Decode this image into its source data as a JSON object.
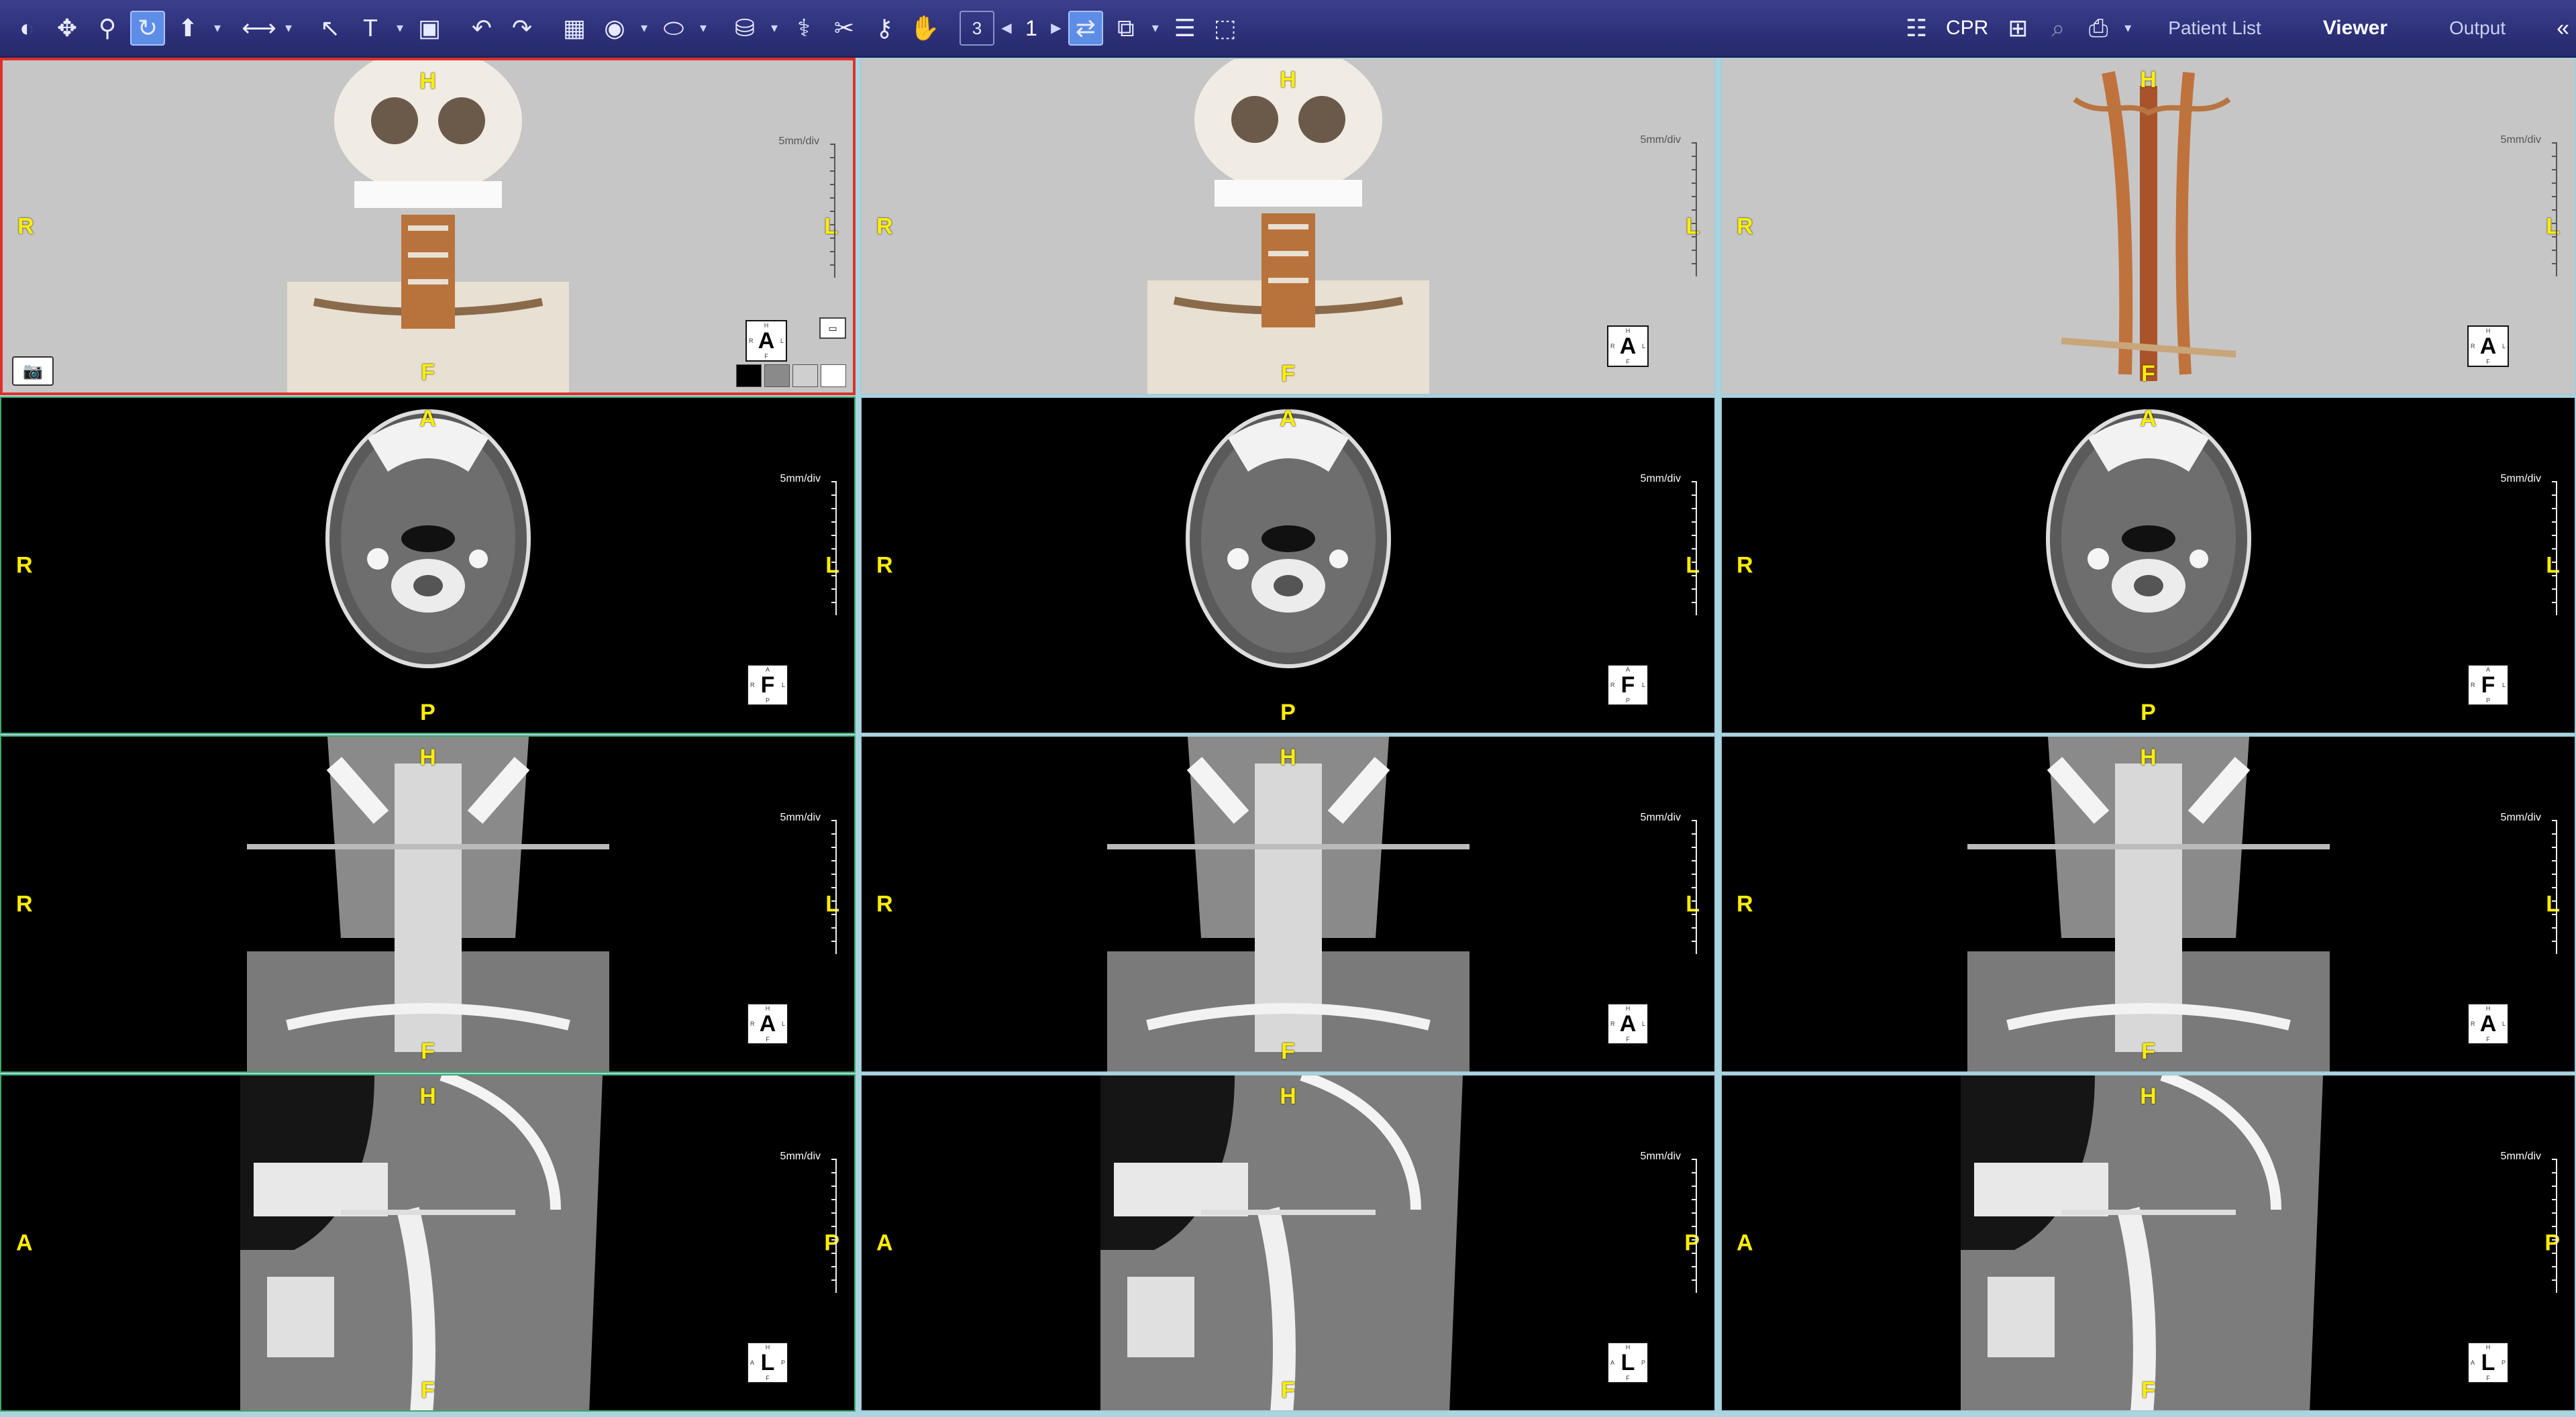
{
  "toolbar": {
    "page_number": "1",
    "layout_number": "3",
    "cpr_label": "CPR",
    "nav": {
      "patient_list": "Patient List",
      "viewer": "Viewer",
      "output": "Output"
    },
    "icons": [
      "window-level-icon",
      "pan-icon",
      "zoom-icon",
      "rotate-icon",
      "3d-rotate-icon",
      "ruler-icon",
      "pointer-icon",
      "text-icon",
      "add-window-icon",
      "undo-icon",
      "redo-icon",
      "color-map-icon",
      "roi-icon",
      "ellipse-icon",
      "segment-icon",
      "vessel-icon",
      "bone-remove-icon",
      "key-icon",
      "hand-icon",
      "layout-icon",
      "prev-icon",
      "next-icon",
      "sync-icon",
      "clone-icon",
      "stack-icon",
      "capture-icon",
      "list-icon",
      "crosshair-icon",
      "search-icon",
      "print-icon",
      "collapse-icon"
    ]
  },
  "viewports": [
    {
      "row": "vr",
      "top": "H",
      "bottom": "F",
      "left": "R",
      "right": "L",
      "cube": "A",
      "scale": "5mm/div"
    },
    {
      "row": "axial",
      "top": "A",
      "bottom": "P",
      "left": "R",
      "right": "L",
      "cube": "F",
      "scale": "5mm/div"
    },
    {
      "row": "coronal",
      "top": "H",
      "bottom": "F",
      "left": "R",
      "right": "L",
      "cube": "A",
      "scale": "5mm/div"
    },
    {
      "row": "sagittal",
      "top": "H",
      "bottom": "F",
      "left": "A",
      "right": "P",
      "cube": "L",
      "scale": "5mm/div"
    }
  ],
  "cube_mini": {
    "A": {
      "t": "H",
      "b": "F",
      "l": "R",
      "r": "L"
    },
    "F": {
      "t": "A",
      "b": "P",
      "l": "R",
      "r": "L"
    },
    "L": {
      "t": "H",
      "b": "F",
      "l": "A",
      "r": "P"
    }
  },
  "colors": {
    "selected": "#e0302a",
    "active_border": "#3da86a",
    "label": "#ffee00",
    "toolbar": "#2d3078"
  }
}
